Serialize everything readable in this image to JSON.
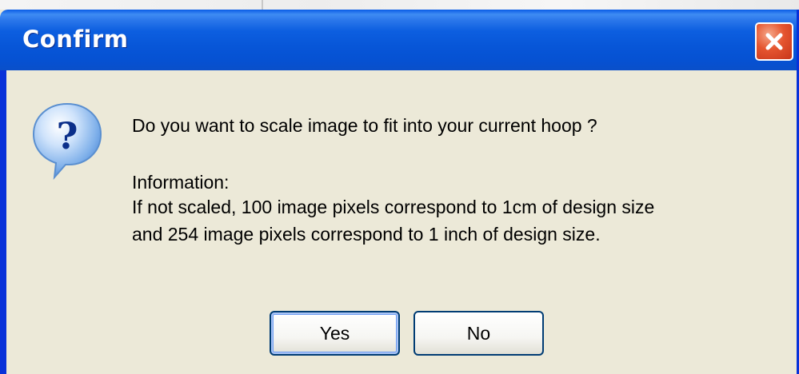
{
  "window": {
    "title": "Confirm"
  },
  "message": {
    "question": "Do you want to scale image to fit into your current hoop ?",
    "info_heading": "Information:",
    "info_line1": "If not scaled, 100 image pixels correspond to 1cm of design size",
    "info_line2": "and 254 image pixels correspond to 1 inch of design size."
  },
  "buttons": {
    "yes_label": "Yes",
    "no_label": "No"
  },
  "icons": {
    "close": "close-icon",
    "dialog": "question-icon"
  },
  "colors": {
    "titlebar": "#0756d8",
    "dialog_face": "#ece9d8",
    "close_button": "#e5552f",
    "button_border": "#003c74"
  }
}
